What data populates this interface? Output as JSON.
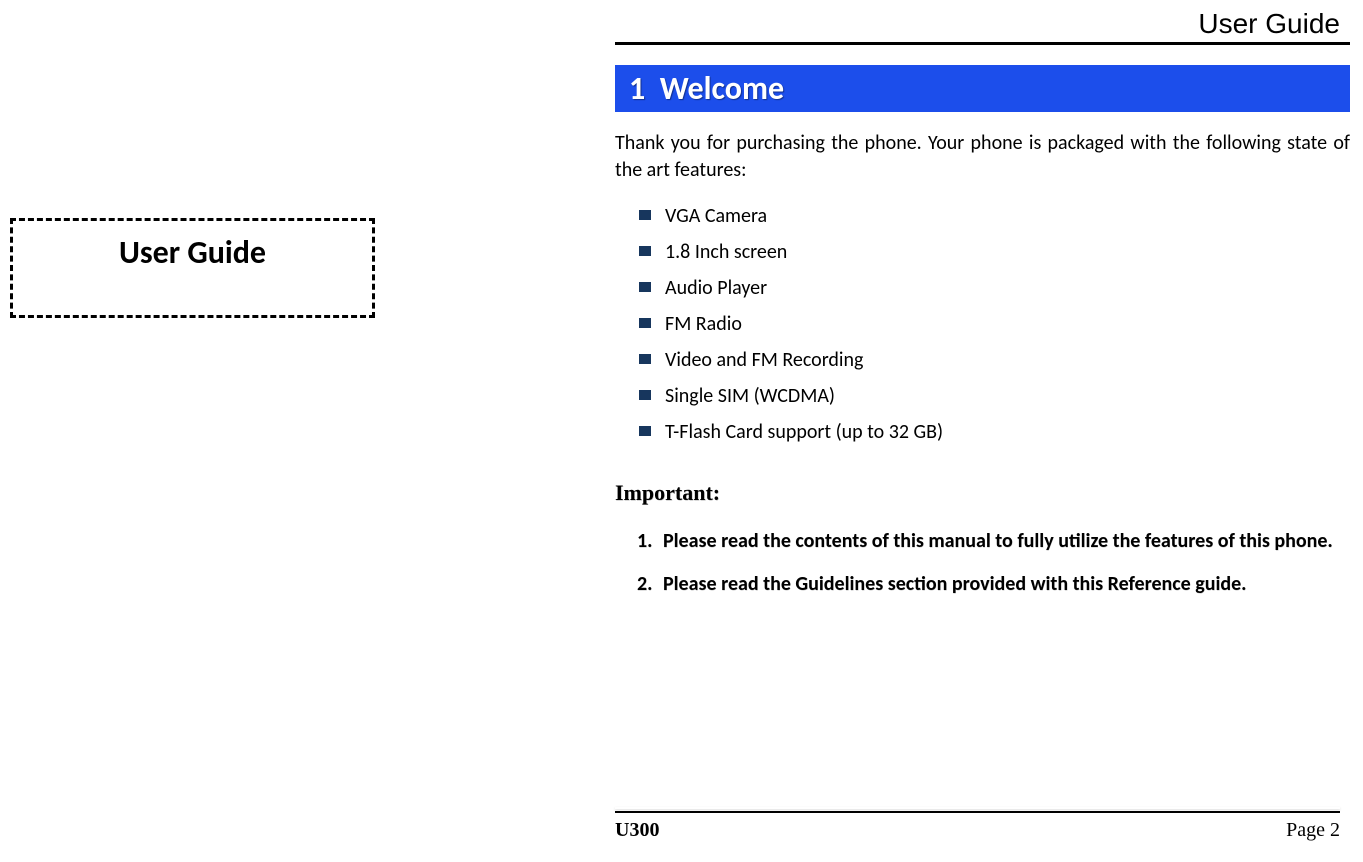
{
  "leftPage": {
    "title": "User Guide"
  },
  "rightPage": {
    "headerTitle": "User Guide",
    "section": {
      "number": "1",
      "title": "Welcome"
    },
    "intro": "Thank you for purchasing the phone. Your phone is packaged with the following state of the art features:",
    "features": [
      "VGA Camera",
      "1.8 Inch screen",
      "Audio Player",
      "FM Radio",
      "Video and FM Recording",
      "Single  SIM (WCDMA)",
      "T-Flash Card support (up to   32 GB)"
    ],
    "importantHeading": "Important:",
    "importantItems": [
      "Please read the contents of this manual to fully utilize the features of this phone.",
      "Please read the Guidelines section provided with this Reference guide."
    ],
    "footer": {
      "model": "U300",
      "page": "Page 2"
    }
  }
}
